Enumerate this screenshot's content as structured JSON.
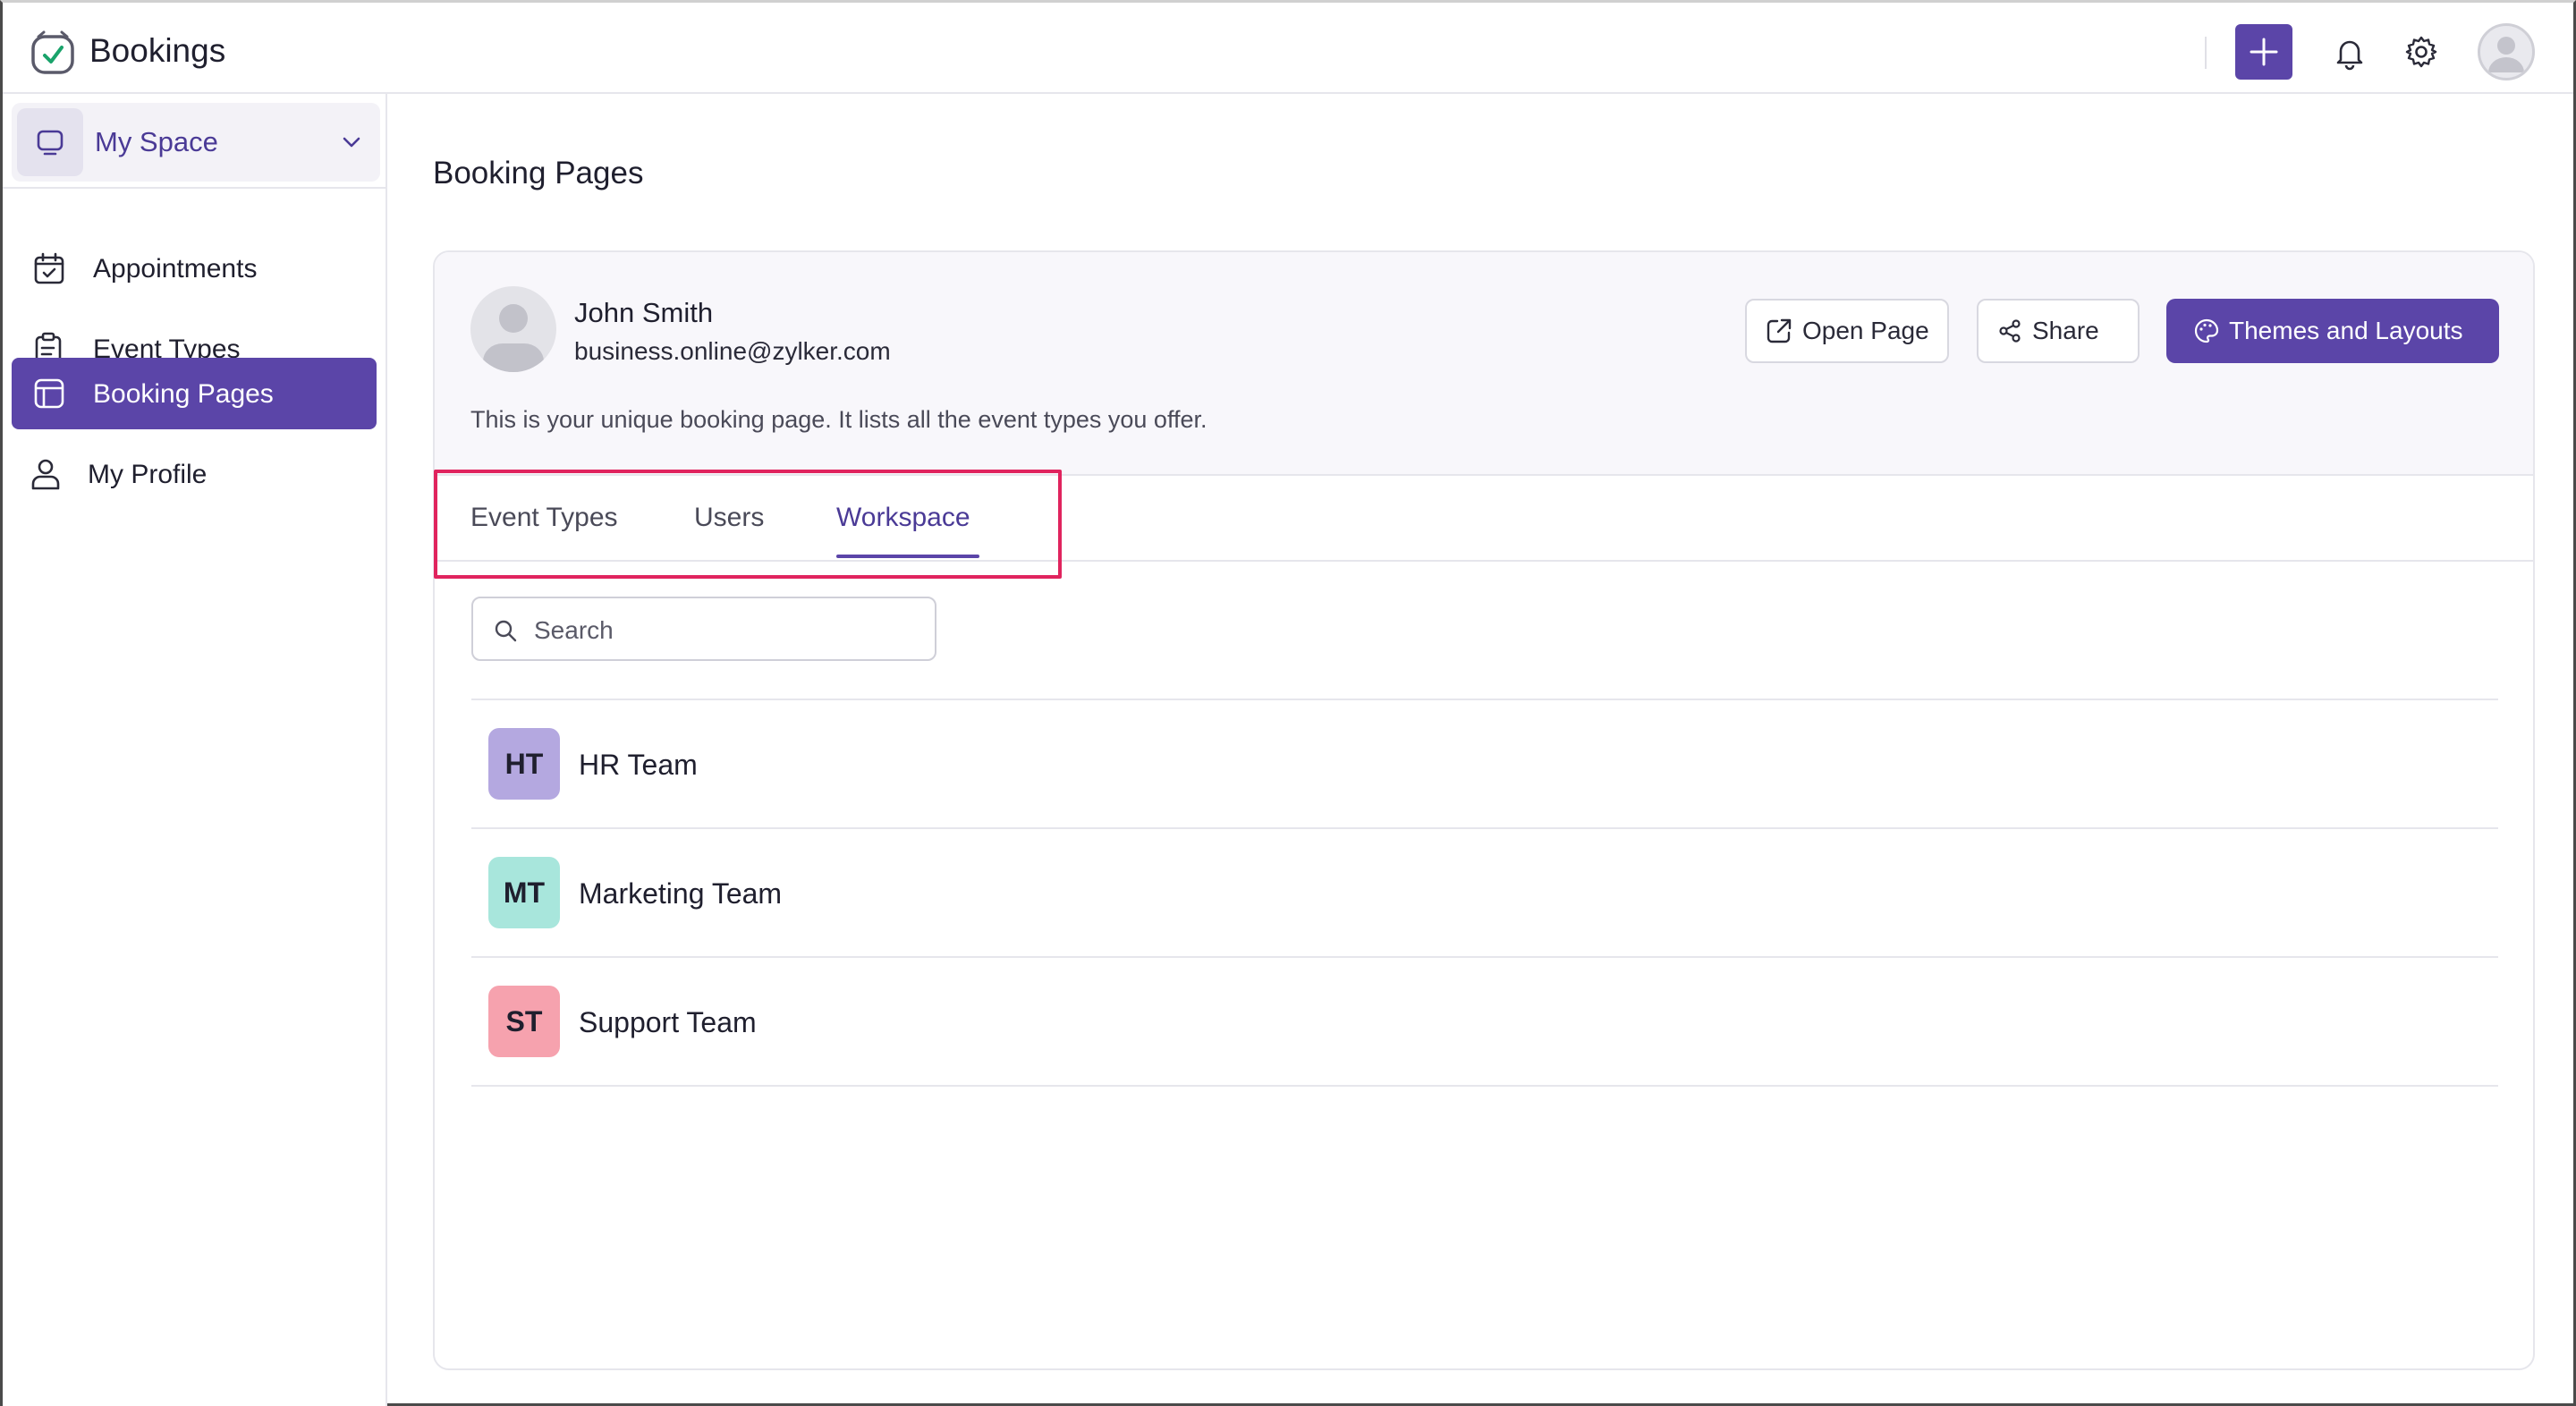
{
  "app": {
    "title": "Bookings"
  },
  "header": {
    "add_icon": "plus-icon",
    "bell_icon": "bell-icon",
    "settings_icon": "gear-icon"
  },
  "sidebar": {
    "space_label": "My Space",
    "items": [
      {
        "label": "Appointments",
        "icon": "calendar-icon",
        "active": false
      },
      {
        "label": "Event Types",
        "icon": "clipboard-icon",
        "active": false
      },
      {
        "label": "Booking Pages",
        "icon": "layout-icon",
        "active": true
      },
      {
        "label": "My Profile",
        "icon": "user-icon",
        "active": false
      }
    ]
  },
  "main": {
    "page_title": "Booking Pages",
    "profile": {
      "name": "John Smith",
      "email": "business.online@zylker.com",
      "description": "This is your unique booking page. It lists all the event types you offer."
    },
    "buttons": {
      "open_page": "Open Page",
      "share": "Share",
      "themes": "Themes and Layouts"
    },
    "tabs": [
      {
        "label": "Event Types",
        "active": false
      },
      {
        "label": "Users",
        "active": false
      },
      {
        "label": "Workspace",
        "active": true
      }
    ],
    "search": {
      "placeholder": "Search"
    },
    "workspaces": [
      {
        "initials": "HT",
        "name": "HR Team",
        "color": "#b4a8e0"
      },
      {
        "initials": "MT",
        "name": "Marketing Team",
        "color": "#a8e6dc"
      },
      {
        "initials": "ST",
        "name": "Support Team",
        "color": "#f6a2ae"
      }
    ]
  },
  "colors": {
    "accent": "#5b45a8",
    "highlight": "#e0245e"
  }
}
